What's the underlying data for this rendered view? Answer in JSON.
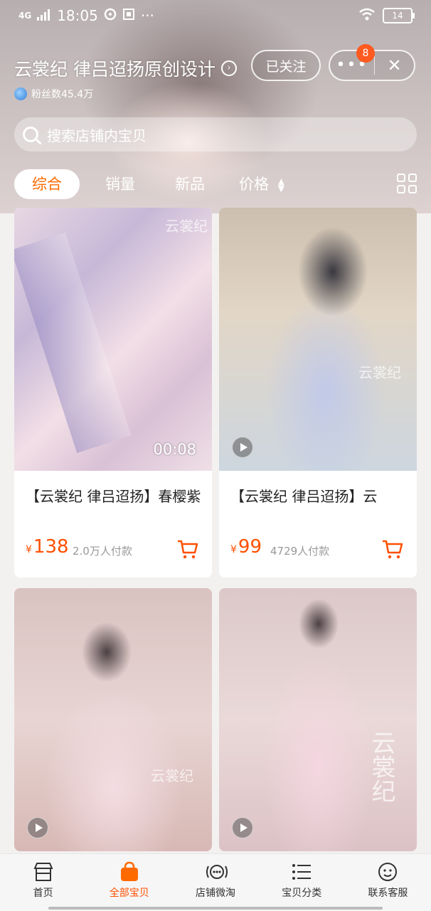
{
  "status_bar": {
    "network": "4G",
    "time": "18:05",
    "extra": "···",
    "battery": "14"
  },
  "header": {
    "shop_name": "云裳纪 律吕迢扬原创设计",
    "fans": "粉丝数45.4万",
    "follow_label": "已关注",
    "more_label": "•••",
    "badge_count": "8",
    "close_label": "✕"
  },
  "search": {
    "placeholder": "搜索店铺内宝贝"
  },
  "sort": {
    "items": [
      "综合",
      "销量",
      "新品",
      "价格"
    ],
    "active": "综合"
  },
  "products": [
    {
      "title": "【云裳纪 律吕迢扬】春樱紫",
      "price": "138",
      "currency": "¥",
      "sold": "2.0万人付款",
      "duration": "00:08",
      "watermark": "云裳纪"
    },
    {
      "title": "【云裳纪 律吕迢扬】云",
      "price": "99",
      "currency": "¥",
      "sold": "4729人付款",
      "watermark": "云裳纪"
    },
    {
      "watermark": "云裳纪"
    },
    {
      "watermark": "云裳纪"
    }
  ],
  "tabbar": {
    "items": [
      "首页",
      "全部宝贝",
      "店铺微淘",
      "宝贝分类",
      "联系客服"
    ],
    "active": "全部宝贝"
  },
  "colors": {
    "accent": "#ff5000",
    "active_sort_text": "#ff6a00"
  }
}
